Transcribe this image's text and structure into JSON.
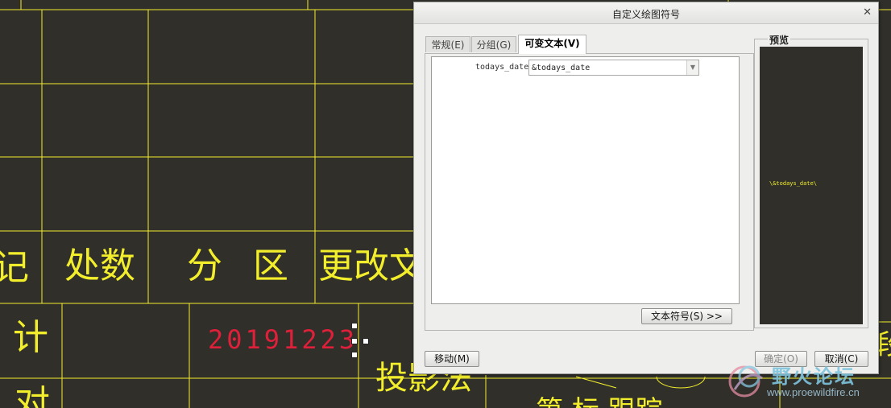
{
  "drawing": {
    "header_cells": [
      "记",
      "处数",
      "分 区",
      "更改文"
    ],
    "row_label_1": "计",
    "date_value": "20191223",
    "bottom_text": "投影法",
    "row_label_2": "对",
    "partial_right_text": "段",
    "partial_bottom_text": "第   标  跟踪",
    "line_color": "#f2ee2c",
    "background_color": "#302f2a",
    "date_color": "#e0203a"
  },
  "dialog": {
    "title": "自定义绘图符号",
    "tabs": [
      {
        "label": "常规(E)",
        "active": false
      },
      {
        "label": "分组(G)",
        "active": false
      },
      {
        "label": "可变文本(V)",
        "active": true
      }
    ],
    "variable": {
      "name": "todays_date",
      "value": "&todays_date"
    },
    "text_symbol_button": "文本符号(S) >>",
    "preview_label": "预览",
    "preview_text": "\\&todays_date\\",
    "move_button": "移动(M)",
    "ok_button": "确定(O)",
    "cancel_button": "取消(C)"
  },
  "watermark": {
    "title": "野火论坛",
    "url": "www.proewildfire.cn"
  }
}
